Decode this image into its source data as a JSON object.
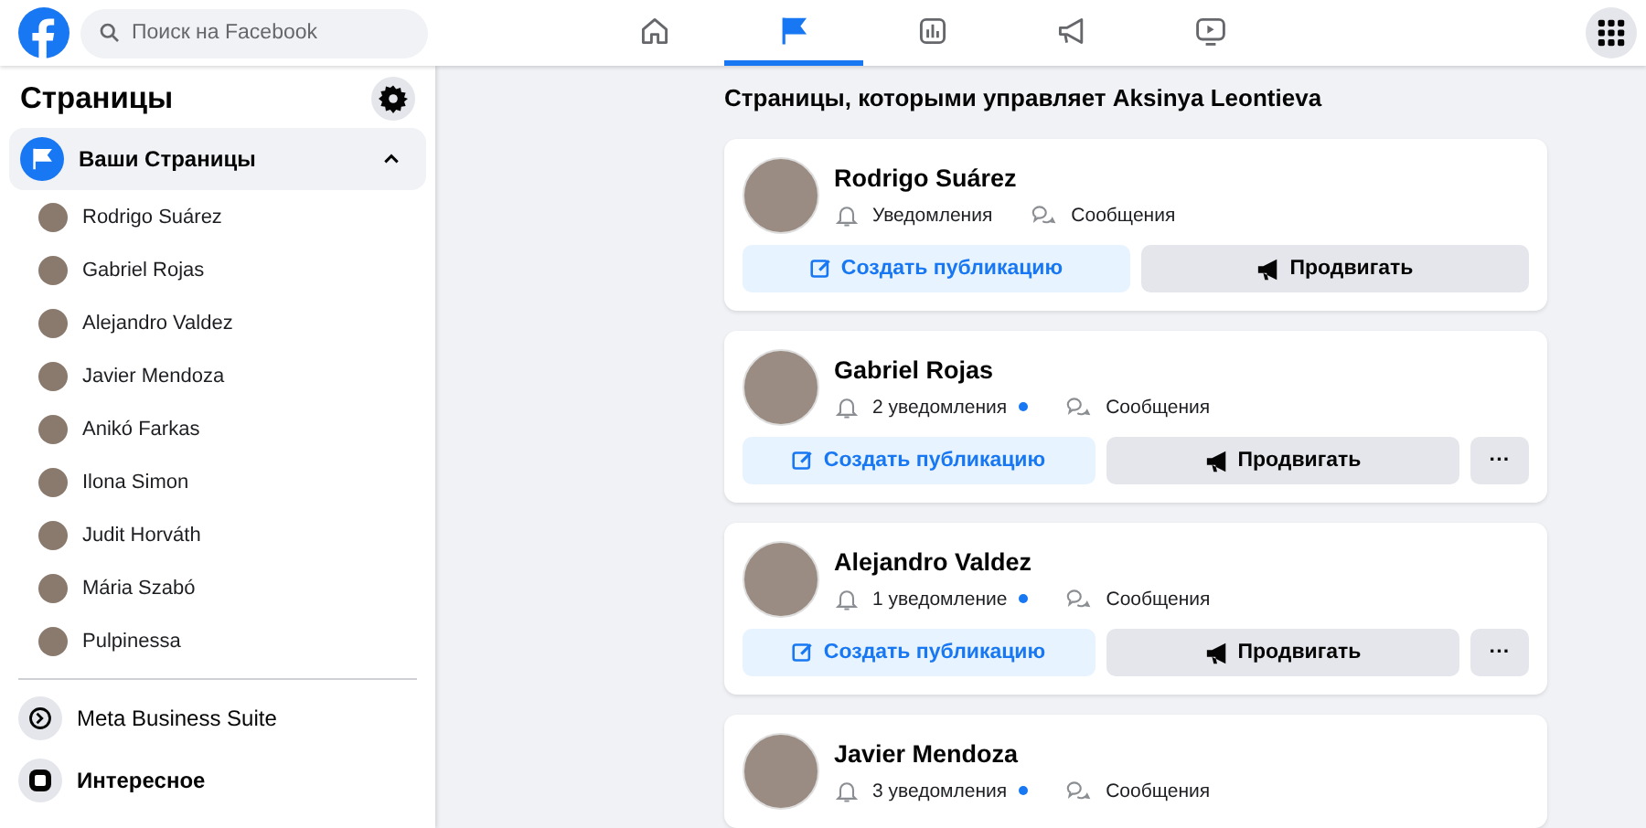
{
  "search": {
    "placeholder": "Поиск на Facebook"
  },
  "nav_tabs": [
    {
      "kind": "home",
      "selected": false
    },
    {
      "kind": "pages",
      "selected": true
    },
    {
      "kind": "insights",
      "selected": false
    },
    {
      "kind": "ads",
      "selected": false
    },
    {
      "kind": "video",
      "selected": false
    }
  ],
  "sidebar": {
    "title": "Страницы",
    "section": {
      "label": "Ваши Страницы",
      "expanded": true,
      "selected": true
    },
    "pages": [
      {
        "name": "Rodrigo Suárez"
      },
      {
        "name": "Gabriel Rojas"
      },
      {
        "name": "Alejandro Valdez"
      },
      {
        "name": "Javier Mendoza"
      },
      {
        "name": "Anikó Farkas"
      },
      {
        "name": "Ilona Simon"
      },
      {
        "name": "Judit Horváth"
      },
      {
        "name": "Mária Szabó"
      },
      {
        "name": "Pulpinessa"
      }
    ],
    "links": [
      {
        "kind": "business",
        "label": "Meta Business Suite"
      },
      {
        "kind": "discover",
        "label": "Интересное"
      }
    ]
  },
  "main": {
    "heading": "Страницы, которыми управляет Aksinya Leontieva",
    "cards": [
      {
        "name": "Rodrigo Suárez",
        "notifications": "Уведомления",
        "unread": false,
        "messages": "Сообщения",
        "buttons": [
          {
            "kind": "create",
            "label": "Создать публикацию"
          },
          {
            "kind": "promote",
            "label": "Продвигать"
          }
        ]
      },
      {
        "name": "Gabriel Rojas",
        "notifications": "2 уведомления",
        "unread": true,
        "messages": "Сообщения",
        "buttons": [
          {
            "kind": "create",
            "label": "Создать публикацию"
          },
          {
            "kind": "promote",
            "label": "Продвигать"
          },
          {
            "kind": "more",
            "label": "···"
          }
        ]
      },
      {
        "name": "Alejandro Valdez",
        "notifications": "1 уведомление",
        "unread": true,
        "messages": "Сообщения",
        "buttons": [
          {
            "kind": "create",
            "label": "Создать публикацию"
          },
          {
            "kind": "promote",
            "label": "Продвигать"
          },
          {
            "kind": "more",
            "label": "···"
          }
        ]
      },
      {
        "name": "Javier Mendoza",
        "notifications": "3 уведомления",
        "unread": true,
        "messages": "Сообщения"
      }
    ]
  }
}
